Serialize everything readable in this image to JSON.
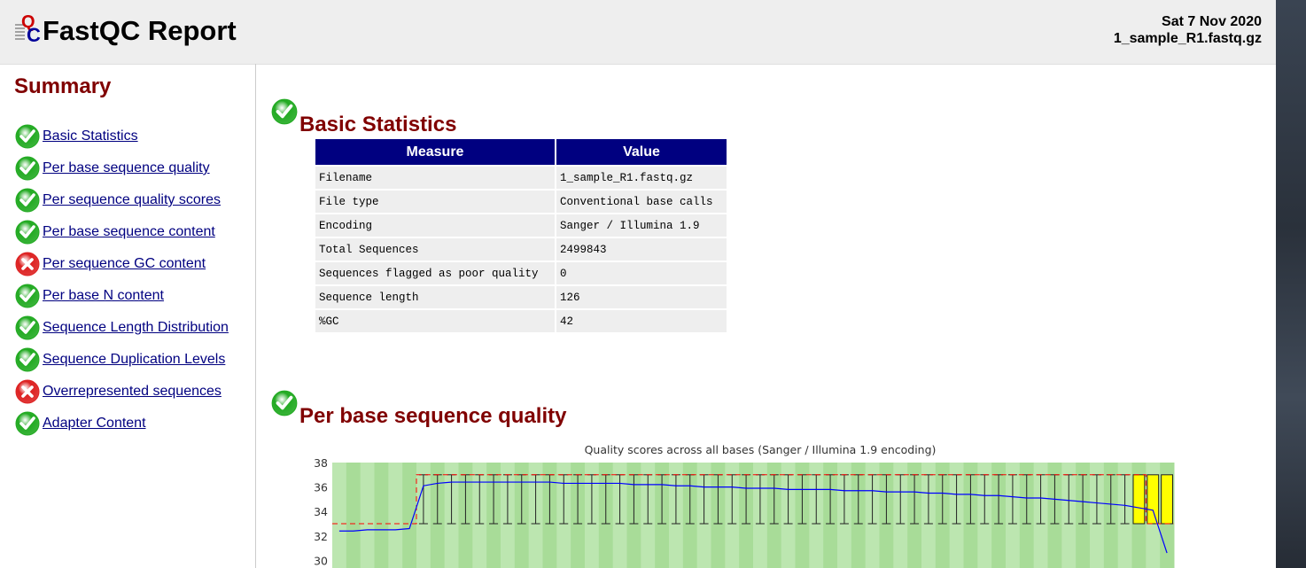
{
  "header": {
    "title": "FastQC Report",
    "date": "Sat 7 Nov 2020",
    "filename": "1_sample_R1.fastq.gz"
  },
  "summary": {
    "heading": "Summary",
    "items": [
      {
        "label": "Basic Statistics",
        "status": "pass"
      },
      {
        "label": "Per base sequence quality",
        "status": "pass"
      },
      {
        "label": "Per sequence quality scores",
        "status": "pass"
      },
      {
        "label": "Per base sequence content",
        "status": "pass"
      },
      {
        "label": "Per sequence GC content",
        "status": "fail"
      },
      {
        "label": "Per base N content",
        "status": "pass"
      },
      {
        "label": "Sequence Length Distribution",
        "status": "pass"
      },
      {
        "label": "Sequence Duplication Levels",
        "status": "pass"
      },
      {
        "label": "Overrepresented sequences",
        "status": "fail"
      },
      {
        "label": "Adapter Content",
        "status": "pass"
      }
    ]
  },
  "basic_statistics": {
    "title": "Basic Statistics",
    "headers": [
      "Measure",
      "Value"
    ],
    "rows": [
      [
        "Filename",
        "1_sample_R1.fastq.gz"
      ],
      [
        "File type",
        "Conventional base calls"
      ],
      [
        "Encoding",
        "Sanger / Illumina 1.9"
      ],
      [
        "Total Sequences",
        "2499843"
      ],
      [
        "Sequences flagged as poor quality",
        "0"
      ],
      [
        "Sequence length",
        "126"
      ],
      [
        "%GC",
        "42"
      ]
    ]
  },
  "per_base_quality": {
    "title": "Per base sequence quality"
  },
  "colors": {
    "header_bg": "#eeeeee",
    "accent_red": "#800000",
    "link": "#000080",
    "table_header": "#000080",
    "table_cell": "#eeeeee",
    "pass": "#22aa22",
    "fail": "#dd2222",
    "zone_good": "#b0e0a0",
    "box_yellow": "#ffff00",
    "mean_line": "#0000ff",
    "median_line": "#ff0000"
  },
  "chart_data": {
    "type": "box",
    "title": "Quality scores across all bases (Sanger / Illumina 1.9 encoding)",
    "ylim": [
      30,
      38
    ],
    "y_ticks_visible": [
      38,
      36,
      34,
      32,
      30
    ],
    "positions": 60,
    "mean": [
      32.4,
      32.4,
      32.5,
      32.5,
      32.5,
      32.6,
      36.1,
      36.3,
      36.4,
      36.4,
      36.4,
      36.4,
      36.4,
      36.4,
      36.4,
      36.4,
      36.3,
      36.3,
      36.3,
      36.3,
      36.3,
      36.2,
      36.2,
      36.2,
      36.1,
      36.1,
      36.0,
      36.0,
      36.0,
      35.9,
      35.9,
      35.9,
      35.8,
      35.8,
      35.8,
      35.8,
      35.7,
      35.7,
      35.7,
      35.6,
      35.6,
      35.6,
      35.5,
      35.5,
      35.4,
      35.4,
      35.3,
      35.3,
      35.2,
      35.1,
      35.1,
      35.0,
      34.9,
      34.8,
      34.7,
      34.6,
      34.5,
      34.3,
      34.1,
      30.6
    ],
    "median": [
      33.0,
      33.0,
      33.0,
      33.0,
      33.0,
      33.0,
      37.0,
      37.0,
      37.0,
      37.0,
      37.0,
      37.0,
      37.0,
      37.0,
      37.0,
      37.0,
      37.0,
      37.0,
      37.0,
      37.0,
      37.0,
      37.0,
      37.0,
      37.0,
      37.0,
      37.0,
      37.0,
      37.0,
      37.0,
      37.0,
      37.0,
      37.0,
      37.0,
      37.0,
      37.0,
      37.0,
      37.0,
      37.0,
      37.0,
      37.0,
      37.0,
      37.0,
      37.0,
      37.0,
      37.0,
      37.0,
      37.0,
      37.0,
      37.0,
      37.0,
      37.0,
      37.0,
      37.0,
      37.0,
      37.0,
      37.0,
      37.0,
      37.0,
      33.0,
      33.0
    ],
    "whisker_low": [
      null,
      null,
      null,
      null,
      null,
      null,
      null,
      null,
      null,
      null,
      null,
      null,
      null,
      null,
      null,
      null,
      null,
      null,
      null,
      null,
      null,
      null,
      null,
      null,
      null,
      null,
      null,
      null,
      null,
      null,
      null,
      null,
      null,
      null,
      null,
      null,
      null,
      null,
      null,
      null,
      null,
      null,
      null,
      null,
      null,
      null,
      null,
      null,
      null,
      null,
      null,
      null,
      null,
      null,
      null,
      null,
      null,
      null,
      null,
      null
    ],
    "yellow_box_positions": [
      57,
      58,
      59
    ]
  }
}
